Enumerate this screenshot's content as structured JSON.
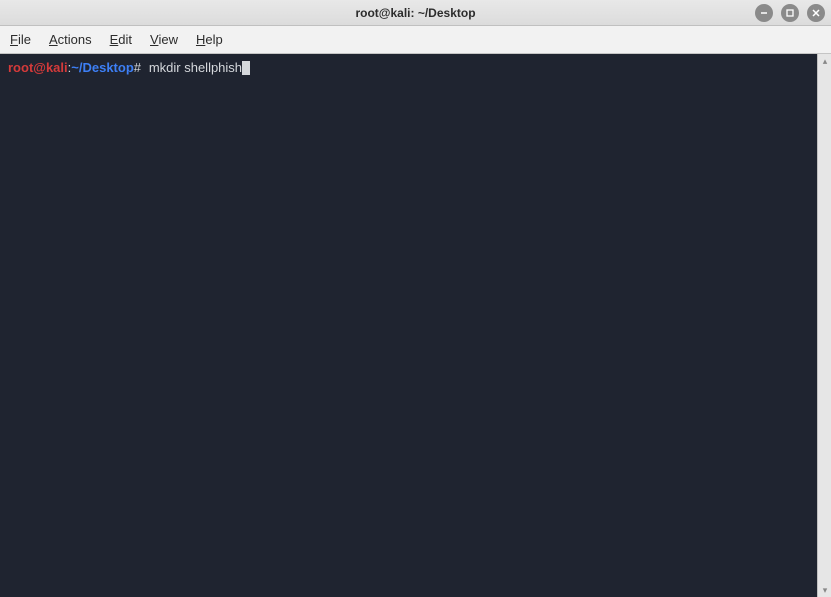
{
  "window": {
    "title": "root@kali: ~/Desktop"
  },
  "menubar": {
    "items": [
      {
        "mnemonic": "F",
        "rest": "ile"
      },
      {
        "mnemonic": "A",
        "rest": "ctions"
      },
      {
        "mnemonic": "E",
        "rest": "dit"
      },
      {
        "mnemonic": "V",
        "rest": "iew"
      },
      {
        "mnemonic": "H",
        "rest": "elp"
      }
    ]
  },
  "terminal": {
    "prompt": {
      "user": "root@kali",
      "colon": ":",
      "path": "~/Desktop",
      "hash": "#"
    },
    "command": "mkdir shellphish"
  },
  "colors": {
    "terminal_bg": "#1f2430",
    "prompt_user": "#d43a3a",
    "prompt_path": "#3d7ff5",
    "text": "#d5d8dc"
  }
}
